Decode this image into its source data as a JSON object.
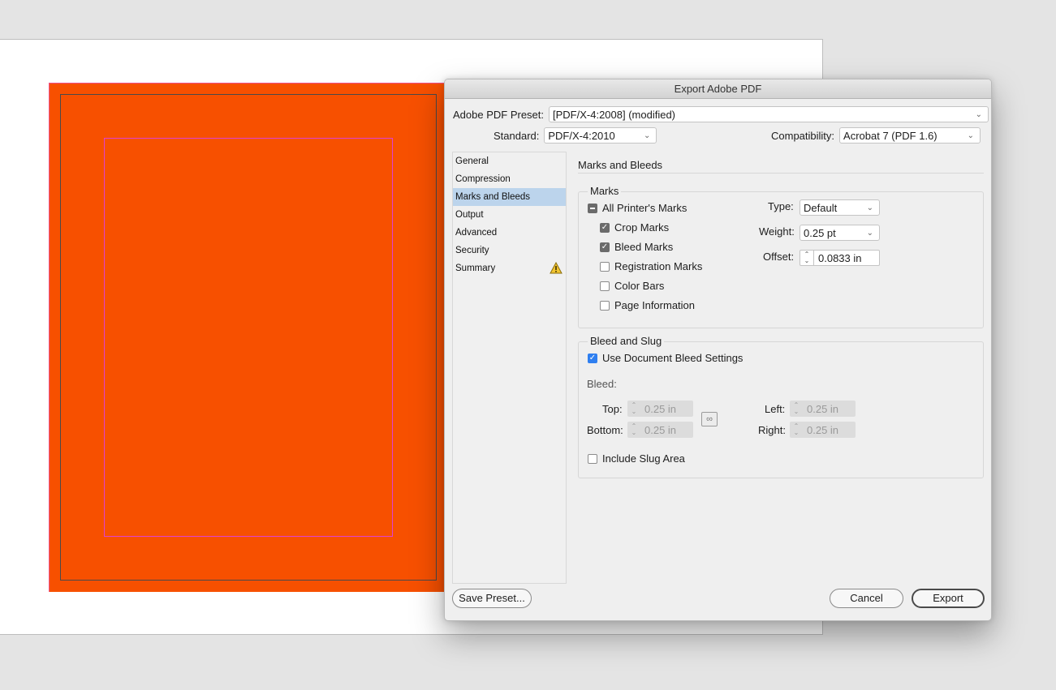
{
  "dialog": {
    "title": "Export Adobe PDF",
    "preset_label": "Adobe PDF Preset:",
    "preset_value": "[PDF/X-4:2008] (modified)",
    "standard_label": "Standard:",
    "standard_value": "PDF/X-4:2010",
    "compatibility_label": "Compatibility:",
    "compatibility_value": "Acrobat 7 (PDF 1.6)"
  },
  "sidebar": {
    "items": [
      {
        "label": "General"
      },
      {
        "label": "Compression"
      },
      {
        "label": "Marks and Bleeds"
      },
      {
        "label": "Output"
      },
      {
        "label": "Advanced"
      },
      {
        "label": "Security"
      },
      {
        "label": "Summary"
      }
    ],
    "active": "Marks and Bleeds",
    "warning_icon": "warning-triangle-icon"
  },
  "panel": {
    "title": "Marks and Bleeds",
    "marks": {
      "group_title": "Marks",
      "all_printers_marks": {
        "label": "All Printer's Marks",
        "state": "mixed"
      },
      "options": [
        {
          "label": "Crop Marks",
          "checked": true
        },
        {
          "label": "Bleed Marks",
          "checked": true
        },
        {
          "label": "Registration Marks",
          "checked": false
        },
        {
          "label": "Color Bars",
          "checked": false
        },
        {
          "label": "Page Information",
          "checked": false
        }
      ],
      "type_label": "Type:",
      "type_value": "Default",
      "weight_label": "Weight:",
      "weight_value": "0.25 pt",
      "offset_label": "Offset:",
      "offset_value": "0.0833 in"
    },
    "bleed_slug": {
      "group_title": "Bleed and Slug",
      "use_document_bleed": {
        "label": "Use Document Bleed Settings",
        "checked": true
      },
      "bleed_label": "Bleed:",
      "top_label": "Top:",
      "top_value": "0.25 in",
      "bottom_label": "Bottom:",
      "bottom_value": "0.25 in",
      "left_label": "Left:",
      "left_value": "0.25 in",
      "right_label": "Right:",
      "right_value": "0.25 in",
      "include_slug": {
        "label": "Include Slug Area",
        "checked": false
      }
    }
  },
  "buttons": {
    "save_preset": "Save Preset...",
    "cancel": "Cancel",
    "export": "Export"
  },
  "colors": {
    "page_fill": "#f75000",
    "selection": "#bcd4ec",
    "checkbox_accent": "#2f7ff0",
    "margin_guide": "#e040d0"
  }
}
